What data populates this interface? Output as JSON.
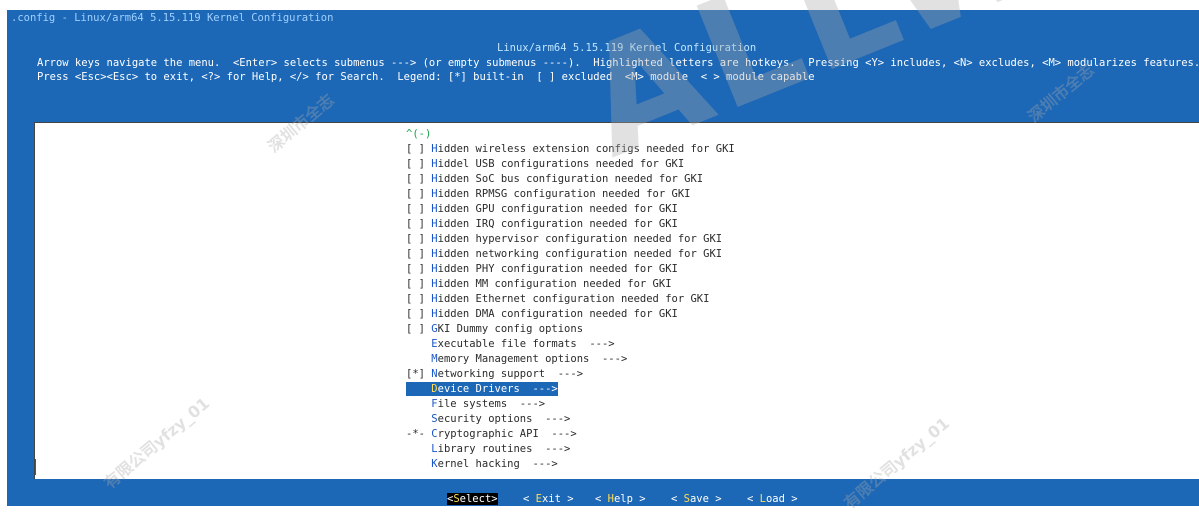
{
  "window": {
    "title": ".config - Linux/arm64 5.15.119 Kernel Configuration"
  },
  "header": {
    "title": "Linux/arm64 5.15.119 Kernel Configuration",
    "help_line_1": "Arrow keys navigate the menu.  <Enter> selects submenus ---> (or empty submenus ----).  Highlighted letters are hotkeys.  Pressing <Y> includes, <N> excludes, <M> modularizes features.",
    "help_line_2": "Press <Esc><Esc> to exit, <?> for Help, </> for Search.  Legend: [*] built-in  [ ] excluded  <M> module  < > module capable"
  },
  "menu": {
    "scroll_indicator": "^(-)",
    "items": [
      {
        "prefix": "[ ] ",
        "hotkey": "H",
        "rest": "idden wireless extension configs needed for GKI"
      },
      {
        "prefix": "[ ] ",
        "hotkey": "H",
        "rest": "iddel USB configurations needed for GKI"
      },
      {
        "prefix": "[ ] ",
        "hotkey": "H",
        "rest": "idden SoC bus configuration needed for GKI"
      },
      {
        "prefix": "[ ] ",
        "hotkey": "H",
        "rest": "idden RPMSG configuration needed for GKI"
      },
      {
        "prefix": "[ ] ",
        "hotkey": "H",
        "rest": "idden GPU configuration needed for GKI"
      },
      {
        "prefix": "[ ] ",
        "hotkey": "H",
        "rest": "idden IRQ configuration needed for GKI"
      },
      {
        "prefix": "[ ] ",
        "hotkey": "H",
        "rest": "idden hypervisor configuration needed for GKI"
      },
      {
        "prefix": "[ ] ",
        "hotkey": "H",
        "rest": "idden networking configuration needed for GKI"
      },
      {
        "prefix": "[ ] ",
        "hotkey": "H",
        "rest": "idden PHY configuration needed for GKI"
      },
      {
        "prefix": "[ ] ",
        "hotkey": "H",
        "rest": "idden MM configuration needed for GKI"
      },
      {
        "prefix": "[ ] ",
        "hotkey": "H",
        "rest": "idden Ethernet configuration needed for GKI"
      },
      {
        "prefix": "[ ] ",
        "hotkey": "H",
        "rest": "idden DMA configuration needed for GKI"
      },
      {
        "prefix": "[ ] ",
        "hotkey": "G",
        "rest": "KI Dummy config options"
      },
      {
        "prefix": "    ",
        "hotkey": "E",
        "rest": "xecutable file formats  --->"
      },
      {
        "prefix": "    ",
        "hotkey": "M",
        "rest": "emory Management options  --->"
      },
      {
        "prefix": "[*] ",
        "hotkey": "N",
        "rest": "etworking support  --->"
      },
      {
        "prefix": "    ",
        "hotkey": "D",
        "rest": "evice Drivers  --->"
      },
      {
        "prefix": "    ",
        "hotkey": "F",
        "rest": "ile systems  --->"
      },
      {
        "prefix": "    ",
        "hotkey": "S",
        "rest": "ecurity options  --->"
      },
      {
        "prefix": "-*- ",
        "hotkey": "C",
        "rest": "ryptographic API  --->"
      },
      {
        "prefix": "    ",
        "hotkey": "L",
        "rest": "ibrary routines  --->"
      },
      {
        "prefix": "    ",
        "hotkey": "K",
        "rest": "ernel hacking  --->"
      }
    ],
    "selected_index": 16
  },
  "buttons": [
    {
      "open": "<",
      "hotkey": "S",
      "rest": "elect",
      "close": ">"
    },
    {
      "open": "< ",
      "hotkey": "E",
      "rest": "xit",
      "close": " >"
    },
    {
      "open": "< ",
      "hotkey": "H",
      "rest": "elp",
      "close": " >"
    },
    {
      "open": "< ",
      "hotkey": "S",
      "rest": "ave",
      "close": " >"
    },
    {
      "open": "< ",
      "hotkey": "L",
      "rest": "oad",
      "close": " >"
    }
  ],
  "watermark": {
    "logo": "ALLWINER",
    "text_1": "深圳市全志",
    "text_2": "有限公司yfzy_01"
  },
  "colors": {
    "background": "#1c67b6",
    "menu_bg": "#ffffff",
    "hotkey": "#1a56c8",
    "selection": "#1c67b6"
  }
}
